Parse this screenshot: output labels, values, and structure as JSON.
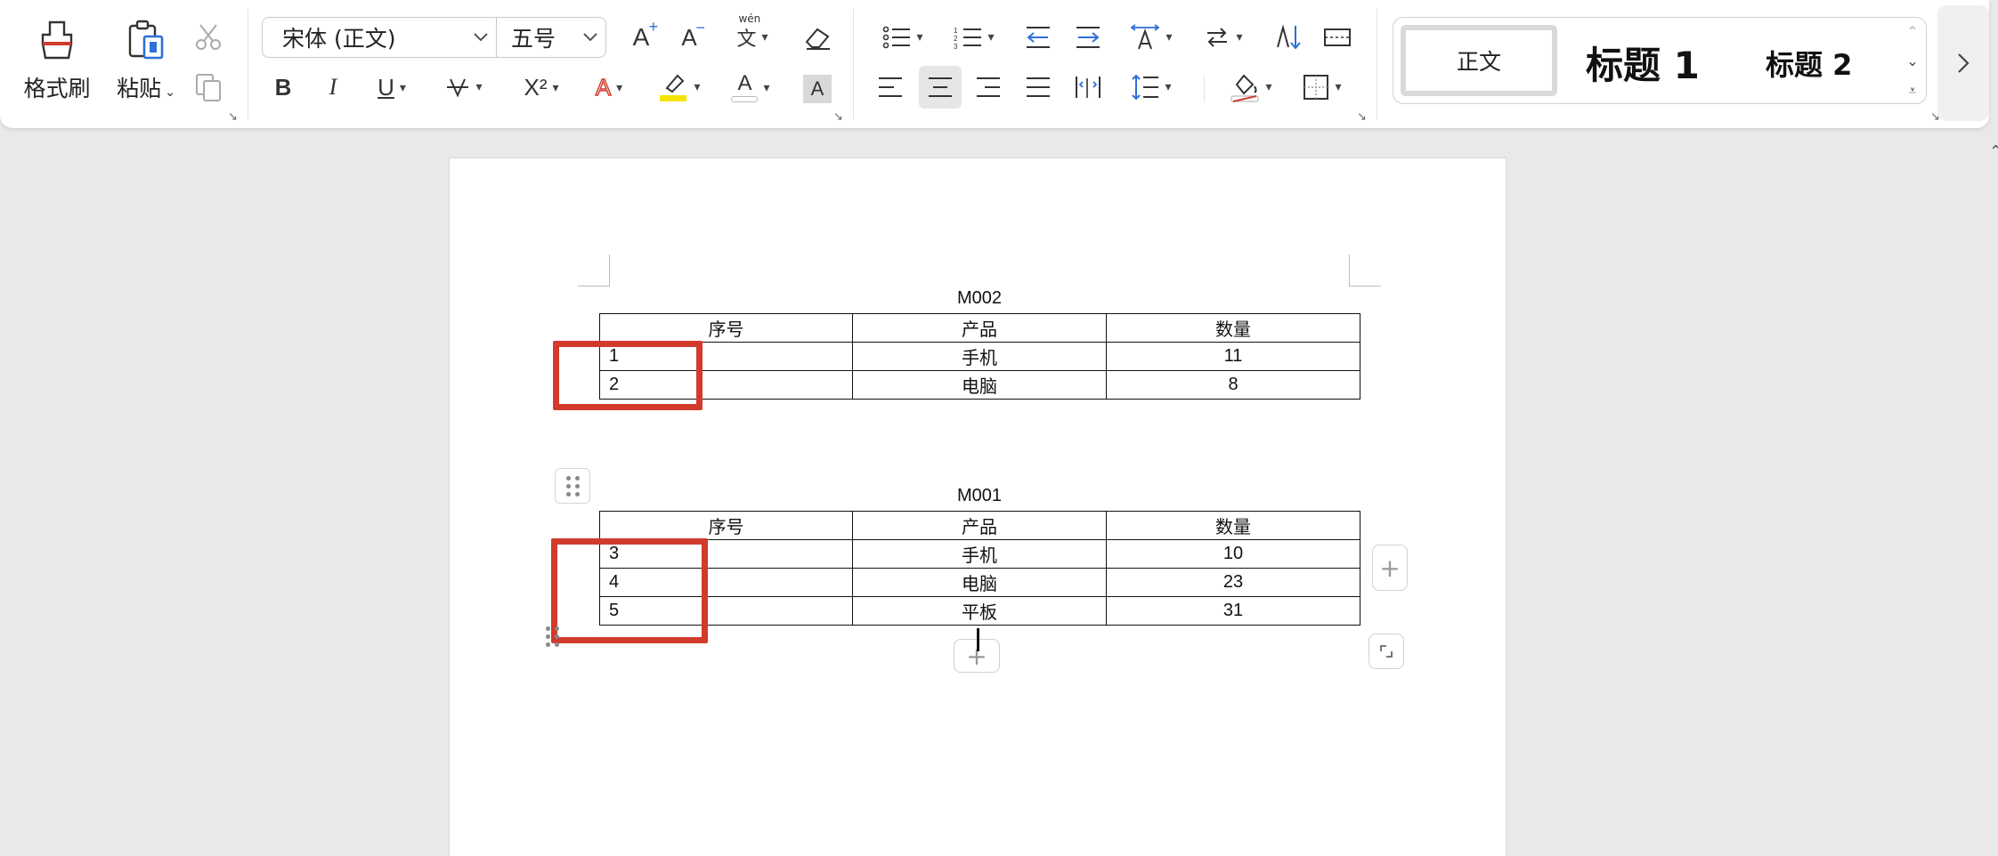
{
  "ribbon": {
    "format_painter_label": "格式刷",
    "paste_label": "粘贴",
    "font_name": "宋体 (正文)",
    "font_size": "五号",
    "grow_font_label": "A",
    "shrink_font_label": "A",
    "phonetic_label": "wén",
    "bold_label": "B",
    "italic_label": "I",
    "underline_label": "U",
    "superscript_label": "X²",
    "text_effect_label": "A",
    "font_color_label": "A",
    "char_shade_label": "A",
    "accent_color": "#2e6fd8",
    "highlight_color": "#f5e400",
    "font_color": "#d23a2c",
    "styles": {
      "normal": "正文",
      "heading1": "标题  1",
      "heading2": "标题  2"
    }
  },
  "document": {
    "tables": [
      {
        "title": "M002",
        "headers": [
          "序号",
          "产品",
          "数量"
        ],
        "rows": [
          [
            "1",
            "手机",
            "11"
          ],
          [
            "2",
            "电脑",
            "8"
          ]
        ]
      },
      {
        "title": "M001",
        "headers": [
          "序号",
          "产品",
          "数量"
        ],
        "rows": [
          [
            "3",
            "手机",
            "10"
          ],
          [
            "4",
            "电脑",
            "23"
          ],
          [
            "5",
            "平板",
            "31"
          ]
        ]
      }
    ],
    "highlight_color": "#d23a2c"
  }
}
